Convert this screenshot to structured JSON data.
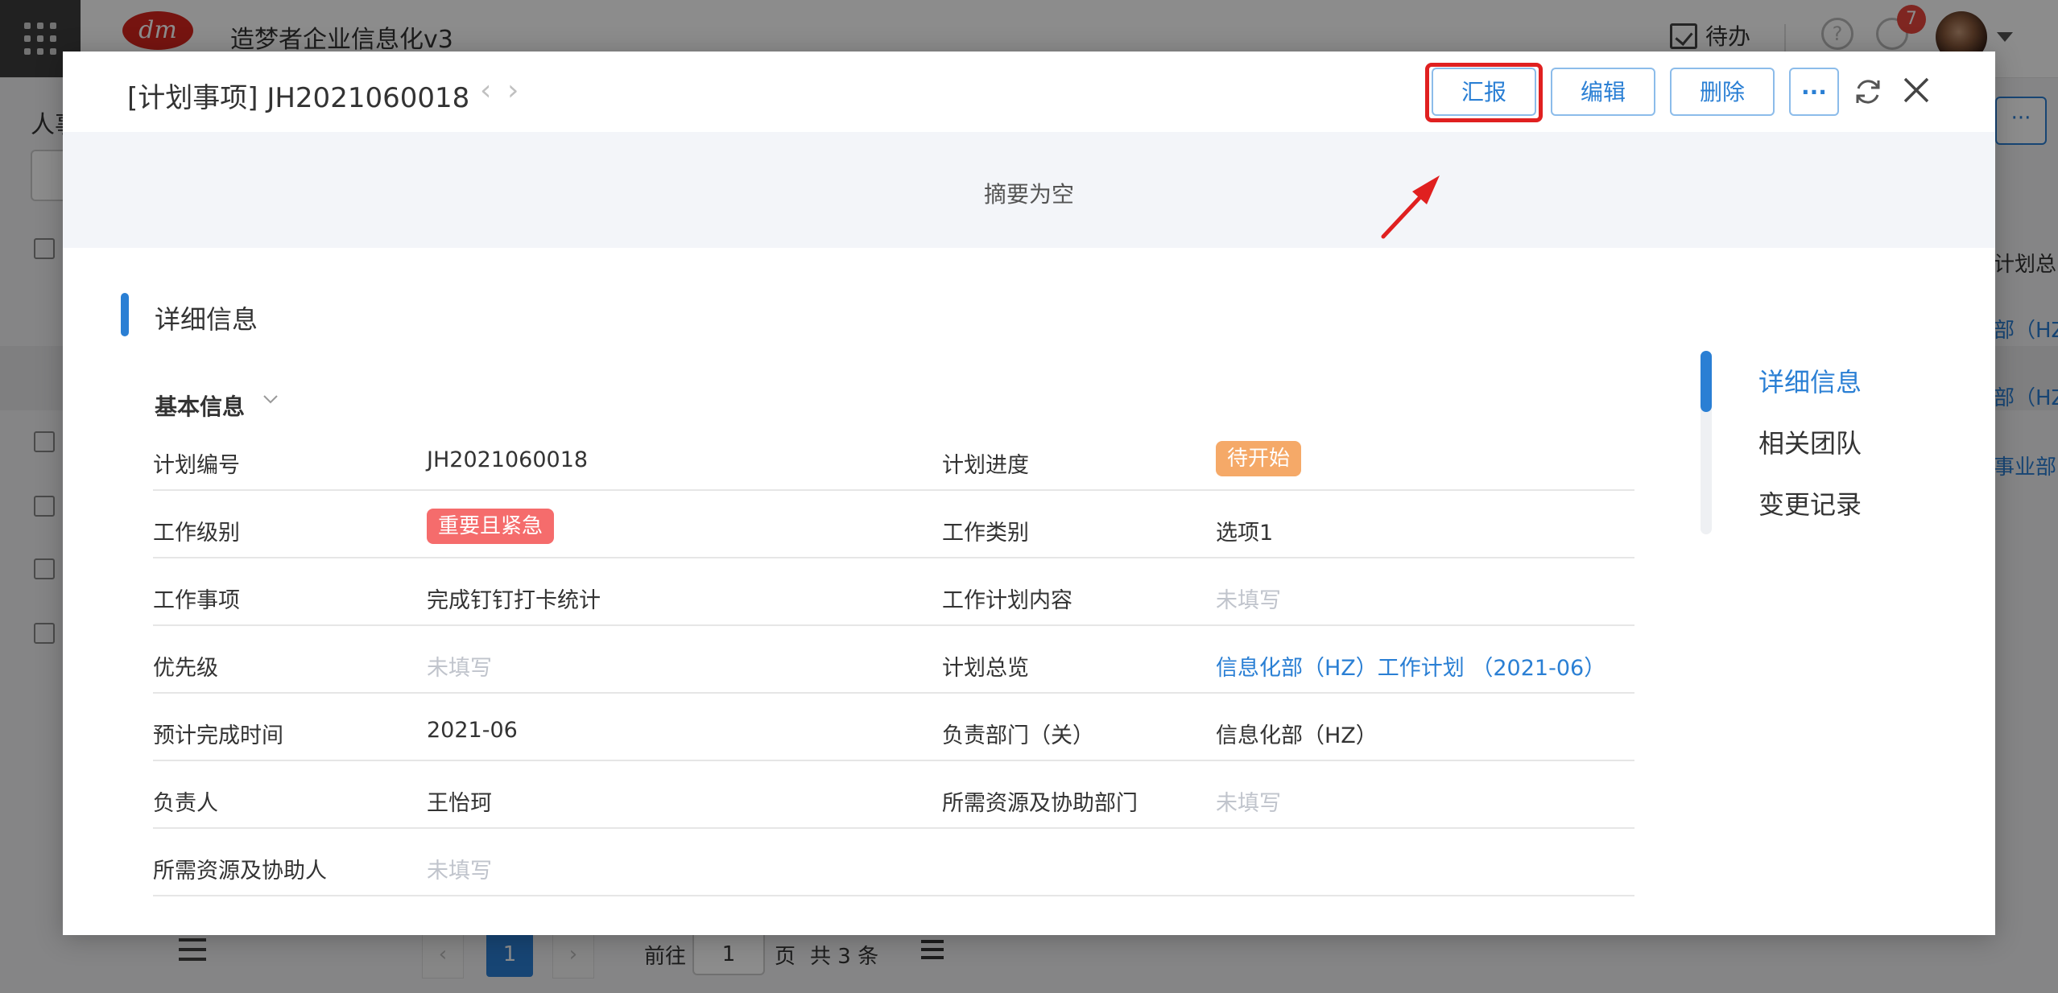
{
  "app": {
    "title": "造梦者企业信息化v3",
    "logo_text": "dm",
    "todo_label": "待办",
    "notification_count": "7",
    "help_glyph": "?"
  },
  "background": {
    "left_label": "人事",
    "right_column": [
      "计划总",
      "部（HZ",
      "部（HZ",
      "事业部"
    ],
    "more_glyph": "···",
    "pager": {
      "prev": "‹",
      "current": "1",
      "next": "›",
      "goto_label": "前往",
      "goto_value": "1",
      "page_unit": "页",
      "total": "共 3 条"
    }
  },
  "modal": {
    "title": "[计划事项] JH2021060018",
    "nav_prev": "‹",
    "nav_next": "›",
    "buttons": {
      "report": "汇报",
      "edit": "编辑",
      "delete": "删除",
      "more": "···"
    },
    "summary": "摘要为空",
    "section_title": "详细信息",
    "group_title": "基本信息",
    "fields_left": [
      {
        "label": "计划编号",
        "value": "JH2021060018",
        "kind": "text"
      },
      {
        "label": "工作级别",
        "value": "重要且紧急",
        "kind": "tag-red"
      },
      {
        "label": "工作事项",
        "value": "完成钉钉打卡统计",
        "kind": "text"
      },
      {
        "label": "优先级",
        "value": "未填写",
        "kind": "empty"
      },
      {
        "label": "预计完成时间",
        "value": "2021-06",
        "kind": "text"
      },
      {
        "label": "负责人",
        "value": "王怡珂",
        "kind": "text"
      },
      {
        "label": "所需资源及协助人",
        "value": "未填写",
        "kind": "empty"
      }
    ],
    "fields_right": [
      {
        "label": "计划进度",
        "value": "待开始",
        "kind": "tag-orange"
      },
      {
        "label": "工作类别",
        "value": "选项1",
        "kind": "text"
      },
      {
        "label": "工作计划内容",
        "value": "未填写",
        "kind": "empty"
      },
      {
        "label": "计划总览",
        "value": "信息化部（HZ）工作计划 （2021-06）",
        "kind": "link"
      },
      {
        "label": "负责部门（关）",
        "value": "信息化部（HZ）",
        "kind": "text"
      },
      {
        "label": "所需资源及协助部门",
        "value": "未填写",
        "kind": "empty"
      }
    ],
    "anchors": [
      "详细信息",
      "相关团队",
      "变更记录"
    ],
    "colors": {
      "accent": "#2a7fd4",
      "tag_red": "#f56c6c",
      "tag_orange": "#f5a968",
      "highlight": "#e02020"
    }
  }
}
